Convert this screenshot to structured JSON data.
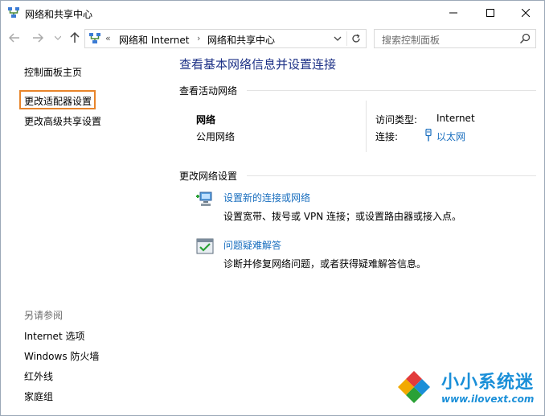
{
  "window": {
    "title": "网络和共享中心"
  },
  "titlebar": {
    "icons": [
      "network-icon",
      "minimize-icon",
      "maximize-icon",
      "close-icon"
    ]
  },
  "nav": {
    "breadcrumb_overflow": "«",
    "breadcrumbs": [
      "网络和 Internet",
      "网络和共享中心"
    ],
    "search_placeholder": "搜索控制面板"
  },
  "sidebar": {
    "home_link": "控制面板主页",
    "links": [
      "更改适配器设置",
      "更改高级共享设置"
    ],
    "highlight_color": "#e8852b",
    "see_also_heading": "另请参阅",
    "see_also": [
      "Internet 选项",
      "Windows 防火墙",
      "红外线",
      "家庭组"
    ]
  },
  "main": {
    "title": "查看基本网络信息并设置连接",
    "active_section": "查看活动网络",
    "network": {
      "name": "网络",
      "category": "公用网络",
      "access_label": "访问类型:",
      "access_value": "Internet",
      "connection_label": "连接:",
      "connection_value": "以太网"
    },
    "change_section": "更改网络设置",
    "tasks": [
      {
        "link": "设置新的连接或网络",
        "desc": "设置宽带、拨号或 VPN 连接；或设置路由器或接入点。",
        "icon": "new-connection-icon"
      },
      {
        "link": "问题疑难解答",
        "desc": "诊断并修复网络问题，或者获得疑难解答信息。",
        "icon": "troubleshoot-icon"
      }
    ]
  },
  "watermark": {
    "name": "小小系统迷",
    "url": "www.ilovext.com"
  },
  "colors": {
    "title_blue": "#1e3287",
    "link_blue": "#1a6fbf",
    "watermark_blue": "#1a8fd8"
  }
}
